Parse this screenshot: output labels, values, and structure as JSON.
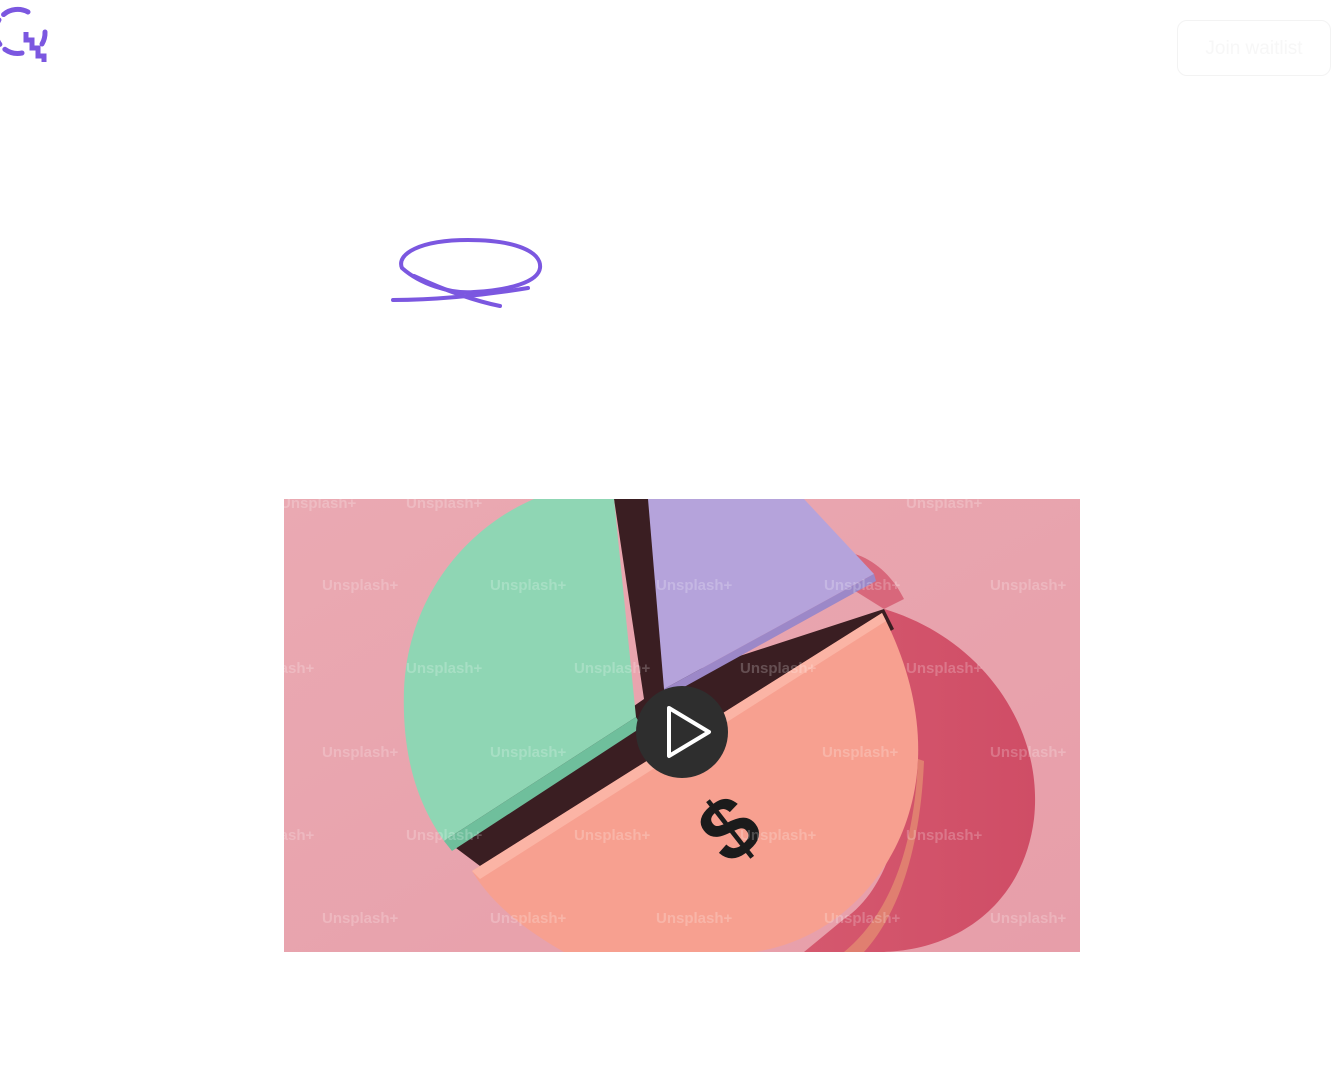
{
  "header": {
    "join_label": "Join waitlist"
  },
  "hero": {
    "highlight_text": ""
  },
  "video": {
    "watermark_text": "Unsplash+",
    "currency_symbol": "$"
  },
  "colors": {
    "brand": "#7b57e0",
    "video_background": "#e9a6b0",
    "slice_green": "#8fd6b4",
    "slice_purple": "#b5a3db",
    "slice_salmon": "#f7a090",
    "play_button": "#2e2e2e"
  },
  "icons": {
    "logo": "brand-logo-icon",
    "play": "play-icon"
  }
}
